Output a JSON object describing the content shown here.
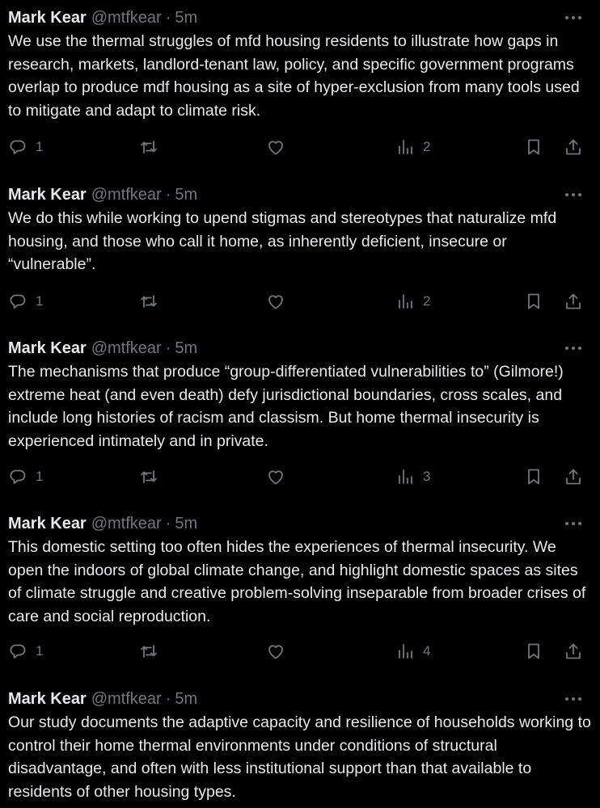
{
  "tweets": [
    {
      "author_name": "Mark Kear",
      "author_handle": "@mtfkear",
      "separator": "·",
      "time": "5m",
      "text": "We use the thermal struggles of mfd housing residents to illustrate how gaps in research, markets, landlord-tenant law, policy, and specific government programs overlap to produce mdf housing as a site of hyper-exclusion from many tools used to mitigate and adapt to climate risk.",
      "reply_count": "1",
      "view_count": "2"
    },
    {
      "author_name": "Mark Kear",
      "author_handle": "@mtfkear",
      "separator": "·",
      "time": "5m",
      "text": "We do this while working to upend stigmas and stereotypes that naturalize mfd housing, and those who call it home, as inherently deficient, insecure or “vulnerable”.",
      "reply_count": "1",
      "view_count": "2"
    },
    {
      "author_name": "Mark Kear",
      "author_handle": "@mtfkear",
      "separator": "·",
      "time": "5m",
      "text": "The mechanisms that produce “group-differentiated vulnerabilities to” (Gilmore!) extreme heat (and even death) defy jurisdictional boundaries, cross scales, and include long histories of racism and classism. But home thermal insecurity is experienced intimately and in private.",
      "reply_count": "1",
      "view_count": "3"
    },
    {
      "author_name": "Mark Kear",
      "author_handle": "@mtfkear",
      "separator": "·",
      "time": "5m",
      "text": "This domestic setting too often hides the experiences of thermal insecurity. We open the indoors of global climate change, and highlight domestic spaces as sites of climate struggle and creative problem-solving inseparable from broader crises of care and social reproduction.",
      "reply_count": "1",
      "view_count": "4"
    },
    {
      "author_name": "Mark Kear",
      "author_handle": "@mtfkear",
      "separator": "·",
      "time": "5m",
      "text": "Our study documents the adaptive capacity and resilience of households working to control their home thermal environments under conditions of structural disadvantage, and often with less institutional support than that available to residents of other housing types."
    }
  ],
  "icons": {
    "more": "more-horizontal-icon",
    "reply": "reply-icon",
    "repost": "repost-icon",
    "like": "heart-icon",
    "views": "views-icon",
    "bookmark": "bookmark-icon",
    "share": "share-icon"
  },
  "colors": {
    "background": "#000000",
    "primary_text": "#e7e9ea",
    "secondary_text": "#71767b"
  }
}
